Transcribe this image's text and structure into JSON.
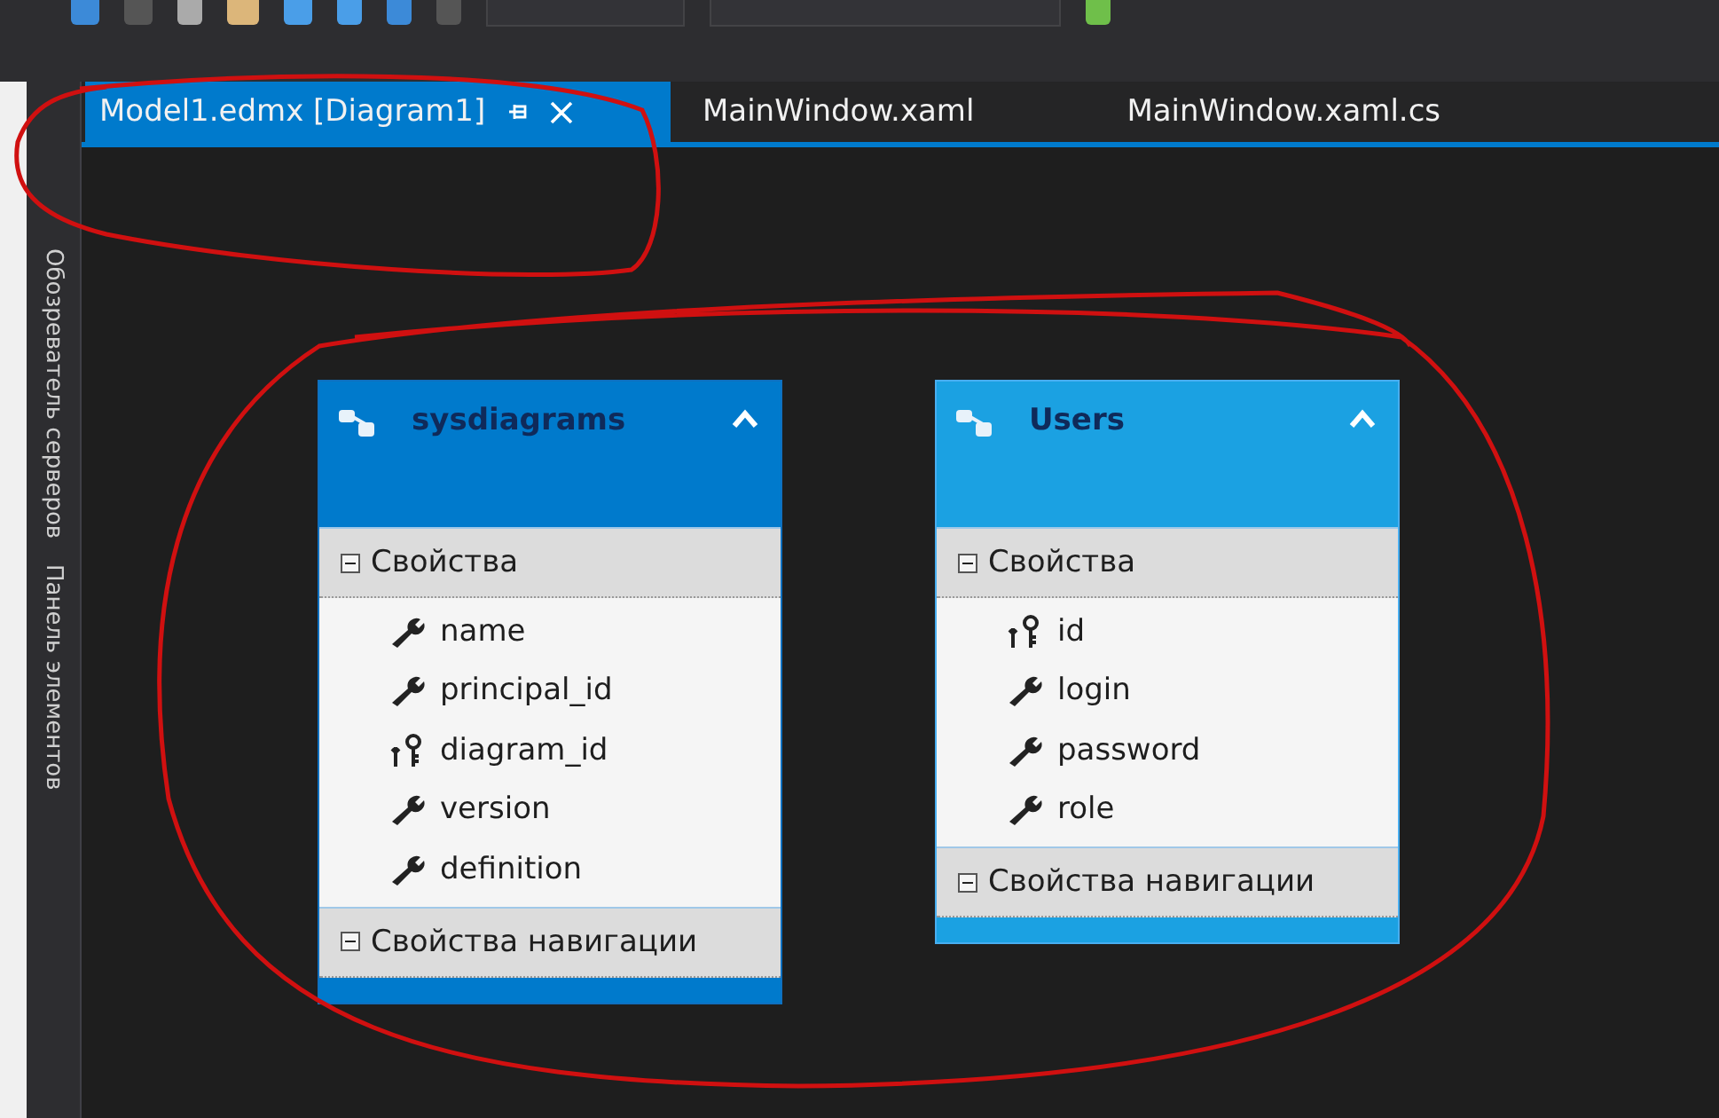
{
  "side_tabs": [
    "Обозреватель серверов",
    "Панель элементов"
  ],
  "tabs": [
    {
      "label": "Model1.edmx [Diagram1]",
      "selected": true
    },
    {
      "label": "MainWindow.xaml",
      "selected": false
    },
    {
      "label": "MainWindow.xaml.cs",
      "selected": false
    }
  ],
  "entities": [
    {
      "name": "sysdiagrams",
      "selected": true,
      "expanded": true,
      "sections": [
        {
          "title": "Свойства",
          "expanded": true,
          "properties": [
            {
              "name": "name",
              "kind": "property"
            },
            {
              "name": "principal_id",
              "kind": "property"
            },
            {
              "name": "diagram_id",
              "kind": "key"
            },
            {
              "name": "version",
              "kind": "property"
            },
            {
              "name": "definition",
              "kind": "property"
            }
          ]
        },
        {
          "title": "Свойства навигации",
          "expanded": true
        }
      ]
    },
    {
      "name": "Users",
      "selected": false,
      "expanded": true,
      "sections": [
        {
          "title": "Свойства",
          "expanded": true,
          "properties": [
            {
              "name": "id",
              "kind": "key"
            },
            {
              "name": "login",
              "kind": "property"
            },
            {
              "name": "password",
              "kind": "property"
            },
            {
              "name": "role",
              "kind": "property"
            }
          ]
        },
        {
          "title": "Свойства навигации",
          "expanded": true
        }
      ]
    }
  ]
}
